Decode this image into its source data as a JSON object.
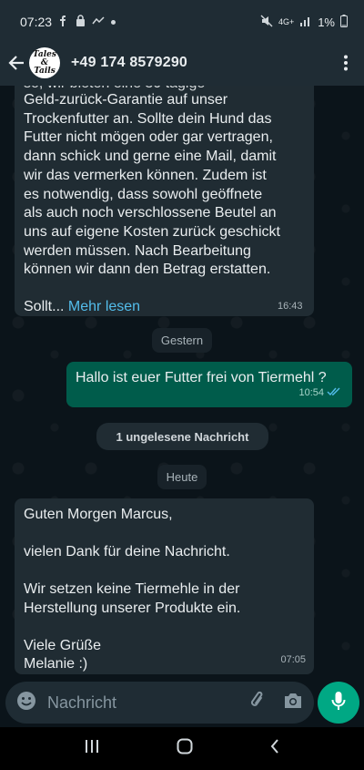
{
  "status_bar": {
    "time": "07:23",
    "left_icons": [
      "facebook-icon",
      "lock-icon",
      "missed-call-icon",
      "dot-icon"
    ],
    "network": "4G+",
    "battery": "1%"
  },
  "header": {
    "contact_name": "+49 174 8579290",
    "avatar_text": "Tales & Tails"
  },
  "messages": {
    "first_in": {
      "text_lines": [
        "Geld-zurück-Garantie auf unser",
        "Trockenfutter an. Sollte dein Hund das",
        "Futter nicht mögen oder gar vertragen,",
        "dann schick und gerne eine Mail, damit",
        "wir das vermerken können. Zudem ist",
        "es notwendig, dass sowohl geöffnete",
        "als auch noch verschlossene Beutel an",
        "uns auf eigene Kosten zurück geschickt",
        "werden müssen. Nach Bearbeitung",
        "können wir dann den Betrag erstatten."
      ],
      "truncated": "Sollt...",
      "read_more": "Mehr lesen",
      "time": "16:43"
    },
    "date_yesterday": "Gestern",
    "outgoing": {
      "text": "Hallo ist euer Futter frei von Tiermehl ?",
      "time": "10:54",
      "status": "read"
    },
    "unread_label": "1 ungelesene Nachricht",
    "date_today": "Heute",
    "second_in": {
      "line1": "Guten Morgen Marcus,",
      "line2": "vielen Dank für deine Nachricht.",
      "line3": "Wir setzen keine Tiermehle in der",
      "line4": "Herstellung unserer Produkte ein.",
      "line5": "Viele Grüße",
      "line6": "Melanie :)",
      "time": "07:05"
    }
  },
  "input": {
    "placeholder": "Nachricht"
  },
  "colors": {
    "background": "#0b141a",
    "bar": "#1f2c34",
    "incoming_bubble": "#202c33",
    "outgoing_bubble": "#005c4b",
    "accent": "#00a884",
    "link": "#53bdeb"
  }
}
